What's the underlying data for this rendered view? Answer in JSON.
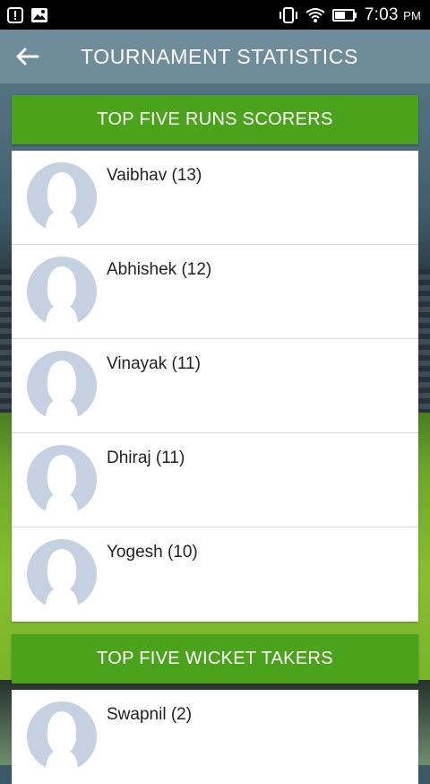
{
  "status_bar": {
    "time": "7:03",
    "ampm": "PM"
  },
  "app_bar": {
    "title": "TOURNAMENT STATISTICS"
  },
  "sections": [
    {
      "title": "TOP FIVE RUNS SCORERS",
      "players": [
        {
          "name": "Vaibhav (13)"
        },
        {
          "name": "Abhishek (12)"
        },
        {
          "name": "Vinayak (11)"
        },
        {
          "name": "Dhiraj (11)"
        },
        {
          "name": "Yogesh (10)"
        }
      ]
    },
    {
      "title": "TOP FIVE WICKET TAKERS",
      "players": [
        {
          "name": "Swapnil (2)"
        }
      ]
    }
  ],
  "colors": {
    "header_green": "#4aa31a",
    "app_bar": "#6f8c9b",
    "avatar_bg": "#c5d1e0"
  }
}
